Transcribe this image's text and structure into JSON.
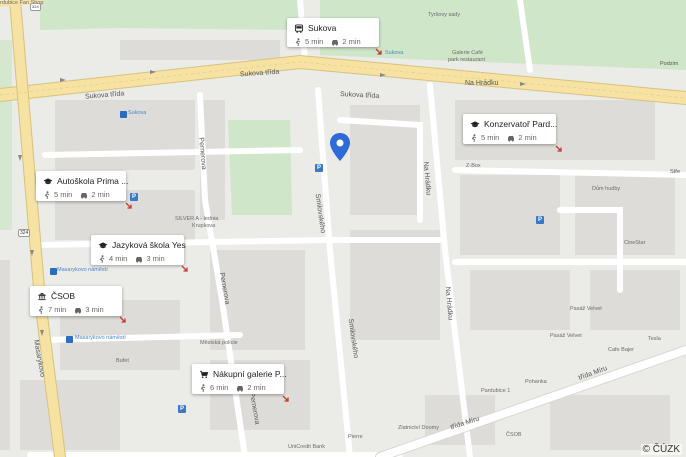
{
  "map": {
    "streets": {
      "sukova_1": "Sukova třída",
      "sukova_2": "Sukova třída",
      "sukova_3": "Sukova třída",
      "na_hradku_1": "Na Hrádku",
      "na_hradku_2": "Na Hrádku",
      "na_hradku_3": "Na Hrádku",
      "smilova_1": "Smilovského",
      "smilova_2": "Smilovského",
      "pernerova_1": "Pernerova",
      "pernerova_2": "Pernerova",
      "pernerova_3": "Pernerova",
      "trida_miru_1": "třída Míru",
      "trida_miru_2": "třída Míru",
      "masarykovo": "Masarykovo",
      "podzim": "Podzim",
      "stre": "Stře"
    },
    "pois": {
      "pardubice_fan_shop": "rdubice Fan Shop",
      "tyrsovy_sady": "Tyršovy sady",
      "galerie_cafe": "Galerie Café",
      "park_restaurant": "park restaurant",
      "sukova_stop": "Sukova",
      "sukova_stop2": "Sukova",
      "z_box": "Z-Box",
      "dum_hudby": "Dům hudby",
      "silver": "SILVER A - lednia",
      "krupkova": "Krupkova",
      "masarykovo_1": "Masarykovo náměstí",
      "masarykovo_2": "Masarykovo náměstí",
      "mestska_policie": "Městská policie",
      "bufet": "Bufet",
      "cinestar": "CineStar",
      "pasaz_velvet_1": "Pasáž Velvet",
      "pasaz_velvet_2": "Pasáž Velvet",
      "cafe_bajer": "Cafe Bajer",
      "tesla": "Tesla",
      "pohanka": "Pohanka",
      "pardubice_1": "Pardubice 1",
      "zlatnictvi": "Zlatnictví Doomy",
      "csob_small": "ČSOB",
      "pierre": "Pierre",
      "unicredit": "UniCredit Bank"
    },
    "road_shields": [
      "324",
      "324"
    ],
    "copyright": "© ČÚZK",
    "colors": {
      "pin": "#2f6bd6",
      "major_road": "#f6e3a4",
      "route_arrow": "#c0392b",
      "park": "#cfe6c9",
      "water": "#b5d3f0"
    }
  },
  "cards": [
    {
      "title": "Sukova",
      "icon": "bus-icon",
      "walk": "5 min",
      "drive": "2 min"
    },
    {
      "title": "Konzervatoř Pard...",
      "icon": "school-icon",
      "walk": "5 min",
      "drive": "2 min"
    },
    {
      "title": "Autoškola Prima ...",
      "icon": "school-icon",
      "walk": "5 min",
      "drive": "2 min"
    },
    {
      "title": "Jazyková škola Yes",
      "icon": "school-icon",
      "walk": "4 min",
      "drive": "3 min"
    },
    {
      "title": "ČSOB",
      "icon": "bank-icon",
      "walk": "7 min",
      "drive": "3 min"
    },
    {
      "title": "Nákupní galerie P...",
      "icon": "shopping-cart-icon",
      "walk": "6 min",
      "drive": "2 min"
    }
  ]
}
